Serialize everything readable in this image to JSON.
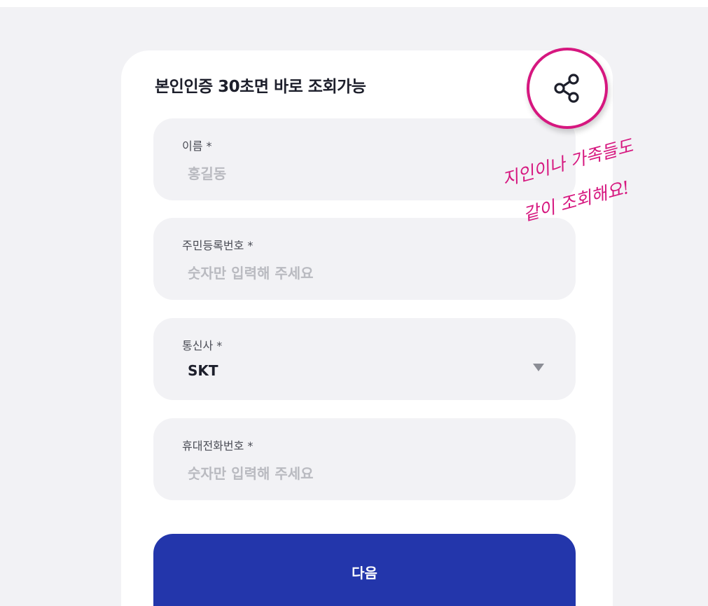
{
  "header": {
    "title": "본인인증 30초면 바로 조회가능"
  },
  "share": {
    "icon": "share-icon",
    "color": "#d6177f"
  },
  "callout": {
    "line1": "지인이나 가족들도",
    "line2": "같이 조회해요!"
  },
  "form": {
    "name": {
      "label": "이름 *",
      "placeholder": "홍길동"
    },
    "resident_number": {
      "label": "주민등록번호 *",
      "placeholder": "숫자만 입력해 주세요"
    },
    "carrier": {
      "label": "통신사 *",
      "value": "SKT",
      "icon": "dropdown-arrow-icon"
    },
    "phone": {
      "label": "휴대전화번호 *",
      "placeholder": "숫자만 입력해 주세요"
    }
  },
  "actions": {
    "next_label": "다음",
    "button_color": "#2336ab"
  }
}
